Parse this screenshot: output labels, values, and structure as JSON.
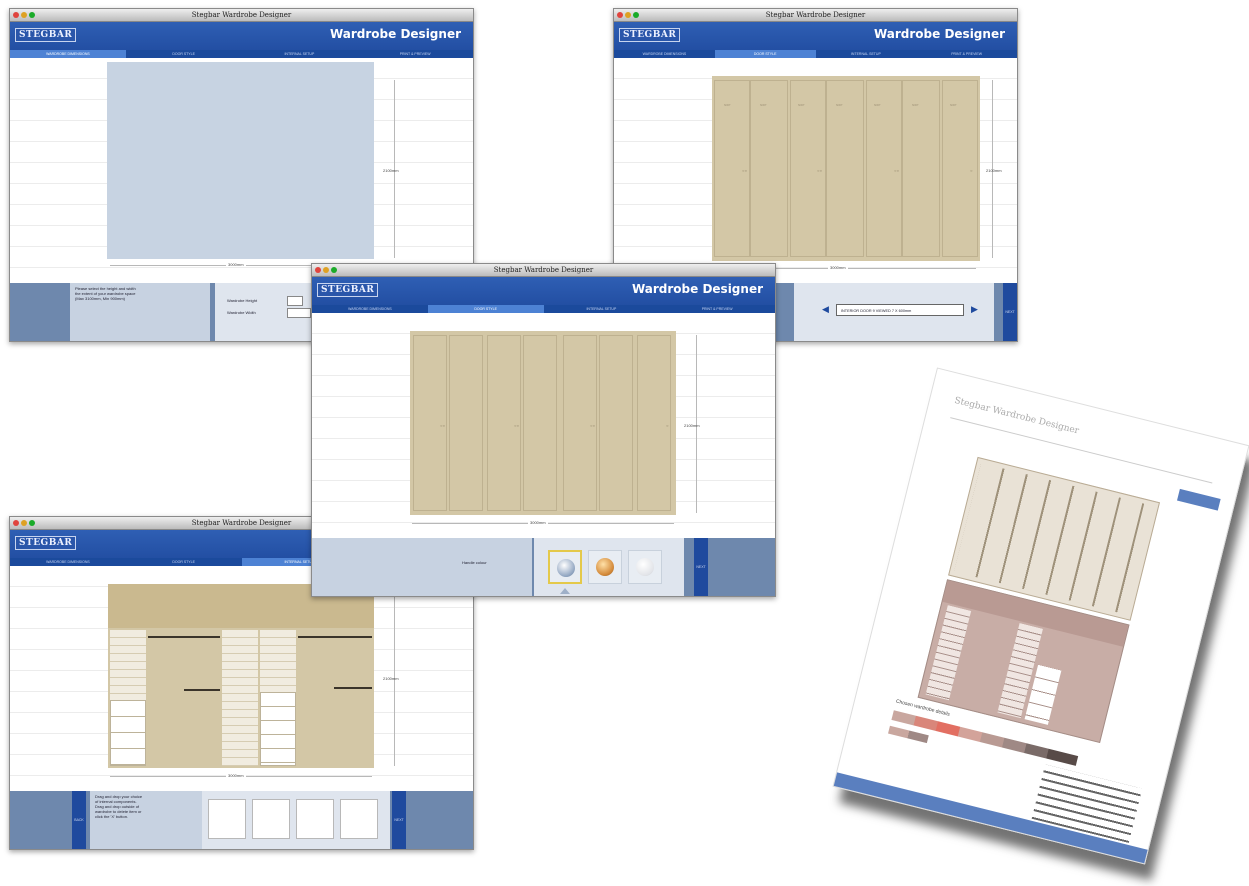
{
  "app": {
    "window_title": "Stegbar Wardrobe Designer",
    "logo": "STEGBAR",
    "app_title": "Wardrobe Designer"
  },
  "tabs": [
    "WARDROBE DIMENSIONS",
    "DOOR STYLE",
    "INTERNAL SETUP",
    "PRINT & PREVIEW"
  ],
  "window1": {
    "height_dim": "2100mm",
    "width_dim": "3000mm",
    "instruction": "Please select the height and width\nthe extent of your wardrobe space\n(Max 3100mm, Min 900mm)",
    "height_label": "Wardrobe Height",
    "width_label": "Wardrobe Width"
  },
  "window2": {
    "height_dim": "2100mm",
    "width_dim": "3000mm",
    "door_label": "SOFT",
    "selector_text": "INTERIOR DOOR 9   VIEWED 7 X 600mm",
    "next": "NEXT"
  },
  "window3": {
    "height_dim": "2100mm",
    "width_dim": "3000mm",
    "footer_label": "Handle colour",
    "next": "NEXT",
    "swatches": [
      "chrome",
      "bronze",
      "white"
    ]
  },
  "window4": {
    "height_dim": "2100mm",
    "width_dim": "3000mm",
    "back": "BACK",
    "next": "NEXT",
    "instruction": "Drag and drop your choice\nof internal components.\nDrag and drop outside of\nwardrobe to delete item or\nclick the 'X' button."
  },
  "printout": {
    "title": "Stegbar Wardrobe Designer",
    "section": "Chosen wardrobe details"
  }
}
